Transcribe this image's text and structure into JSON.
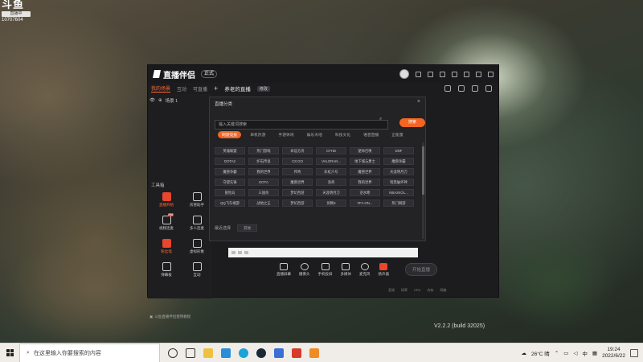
{
  "watermark": {
    "logo": "斗鱼",
    "badge": "直播中",
    "room_id": "10707604"
  },
  "app": {
    "title": "直播伴侣",
    "version_pill": "正式",
    "tabs": [
      "我的场景",
      "互动",
      "可直播"
    ],
    "live_title": "养老的直播",
    "edit_label": "修改",
    "scene_item": "场景 1",
    "tools_heading": "工具箱",
    "tools": [
      {
        "label": "直播开始",
        "icon": "video-camera-icon",
        "badge": "",
        "highlight": true
      },
      {
        "label": "房管助手",
        "icon": "user-icon",
        "badge": "",
        "highlight": false
      },
      {
        "label": "视频连麦",
        "icon": "video-link-icon",
        "badge": "Hot",
        "highlight": false
      },
      {
        "label": "多人连麦",
        "icon": "group-icon",
        "badge": "",
        "highlight": false
      },
      {
        "label": "粉丝墙",
        "icon": "fan-wall-icon",
        "badge": "",
        "highlight": true
      },
      {
        "label": "虚拟形象",
        "icon": "avatar-mask-icon",
        "badge": "",
        "highlight": false
      },
      {
        "label": "弹幕板",
        "icon": "danmaku-icon",
        "badge": "",
        "highlight": false
      },
      {
        "label": "互动",
        "icon": "interact-icon",
        "badge": "",
        "highlight": false
      }
    ],
    "tip_text": "斗鱼直播伴侣使用教程",
    "controls": [
      {
        "label": "直播屏幕",
        "icon": "screen-icon"
      },
      {
        "label": "摄像头",
        "icon": "camera-icon"
      },
      {
        "label": "手机投屏",
        "icon": "phone-cast-icon"
      },
      {
        "label": "多媒体",
        "icon": "media-icon"
      },
      {
        "label": "麦克风",
        "icon": "microphone-icon"
      },
      {
        "label": "扬声器",
        "icon": "speaker-icon"
      }
    ],
    "start_button": "开始直播",
    "status_items": [
      "丢帧",
      "码率",
      "CPU",
      "内存",
      "网络"
    ],
    "version_text": "V2.2.2 (build 32025)"
  },
  "dialog": {
    "title": "直播分类",
    "search_placeholder": "输入关键词搜索",
    "search_button": "搜索",
    "category_tabs": [
      "网游竞技",
      "单机热游",
      "手游休闲",
      "娱乐天地",
      "科技文化",
      "语音直播",
      "正能量"
    ],
    "active_tab": 0,
    "games": [
      "英雄联盟",
      "热门游戏",
      "命运方舟",
      "CFHD",
      "使命召唤",
      "DNF",
      "DOTA2",
      "炉石传说",
      "CS:GO",
      "VALORAN...",
      "地下城与勇士",
      "魔兽争霸",
      "魔兽争霸",
      "我的世界",
      "传奇",
      "彩虹六号",
      "魔兽世界",
      "天涯明月刀",
      "守望先锋",
      "DOTA",
      "魔兽世界",
      "洛奇",
      "我的世界",
      "暗黑破坏神",
      "冒险岛",
      "三国杀",
      "梦幻西游",
      "天涯明月刀",
      "逆水寒",
      "NBA2KOL...",
      "QQ飞车端游",
      "战地之王",
      "梦幻西游",
      "剑网3",
      "FFA ON...",
      "热门网游"
    ],
    "recent_label": "最近选择",
    "recent_items": [
      "其他"
    ]
  },
  "taskbar": {
    "search_text": "在这里输入你要搜索的内容",
    "weather": "26°C 晴",
    "ime": "中",
    "time": "19:24",
    "date": "2022/6/22"
  },
  "colors": {
    "accent": "#f26522",
    "red": "#e8462d"
  }
}
